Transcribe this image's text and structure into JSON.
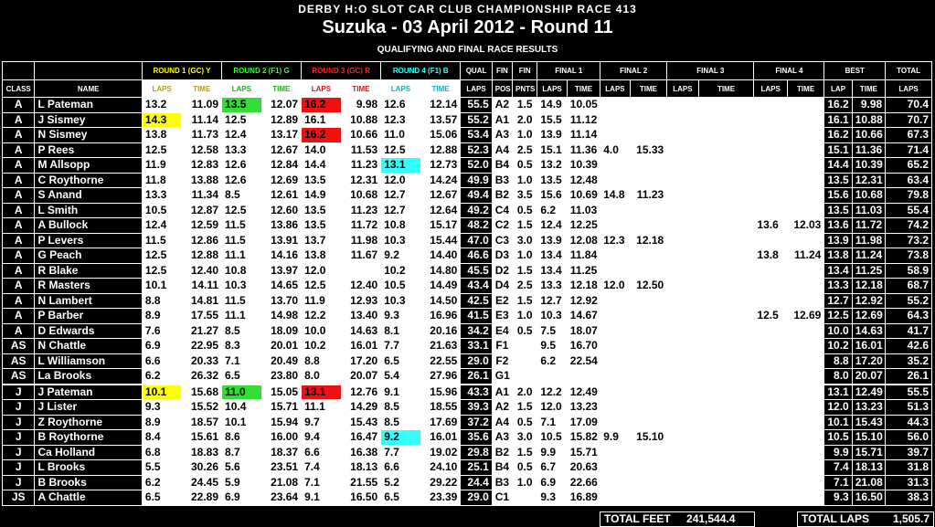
{
  "header": {
    "line1": "DERBY H:O SLOT CAR CLUB CHAMPIONSHIP RACE 413",
    "line2": "Suzuka - 03 April 2012 - Round 11",
    "line3": "QUALIFYING AND FINAL RACE RESULTS"
  },
  "columns": {
    "class": "CLASS",
    "name": "NAME",
    "r1": "ROUND 1 (GC) Y",
    "r2": "ROUND 2 (F1) G",
    "r3": "ROUND 3 (GC) R",
    "r4": "ROUND 4 (F1) B",
    "qual": "QUAL",
    "fin": "FIN",
    "fin2": "FIN",
    "final1": "FINAL 1",
    "final2": "FINAL 2",
    "final3": "FINAL 3",
    "final4": "FINAL 4",
    "best": "BEST",
    "total": "TOTAL",
    "laps": "LAPS",
    "time": "TIME",
    "pos": "POS",
    "pnts": "PNTS",
    "lap": "LAP"
  },
  "rows": [
    [
      "A",
      "L Pateman",
      "13.2",
      "11.09",
      "13.5",
      "12.07",
      "16.2",
      "9.98",
      "12.6",
      "12.14",
      "55.5",
      "A2",
      "1.5",
      "14.9",
      "10.05",
      "",
      "",
      "",
      "",
      "",
      "",
      "16.2",
      "9.98",
      "70.4"
    ],
    [
      "A",
      "J Sismey",
      "14.3",
      "11.14",
      "12.5",
      "12.89",
      "16.1",
      "10.88",
      "12.3",
      "13.57",
      "55.2",
      "A1",
      "2.0",
      "15.5",
      "11.12",
      "",
      "",
      "",
      "",
      "",
      "",
      "16.1",
      "10.88",
      "70.7"
    ],
    [
      "A",
      "N Sismey",
      "13.8",
      "11.73",
      "12.4",
      "13.17",
      "16.2",
      "10.66",
      "11.0",
      "15.06",
      "53.4",
      "A3",
      "1.0",
      "13.9",
      "11.14",
      "",
      "",
      "",
      "",
      "",
      "",
      "16.2",
      "10.66",
      "67.3"
    ],
    [
      "A",
      "P Rees",
      "12.5",
      "12.58",
      "13.3",
      "12.67",
      "14.0",
      "11.53",
      "12.5",
      "12.88",
      "52.3",
      "A4",
      "2.5",
      "15.1",
      "11.36",
      "4.0",
      "15.33",
      "",
      "",
      "",
      "",
      "15.1",
      "11.36",
      "71.4"
    ],
    [
      "A",
      "M Allsopp",
      "11.9",
      "12.83",
      "12.6",
      "12.84",
      "14.4",
      "11.23",
      "13.1",
      "12.73",
      "52.0",
      "B4",
      "0.5",
      "13.2",
      "10.39",
      "",
      "",
      "",
      "",
      "",
      "",
      "14.4",
      "10.39",
      "65.2"
    ],
    [
      "A",
      "C Roythorne",
      "11.8",
      "13.88",
      "12.6",
      "12.69",
      "13.5",
      "12.31",
      "12.0",
      "14.24",
      "49.9",
      "B3",
      "1.0",
      "13.5",
      "12.48",
      "",
      "",
      "",
      "",
      "",
      "",
      "13.5",
      "12.31",
      "63.4"
    ],
    [
      "A",
      "S Anand",
      "13.3",
      "11.34",
      "8.5",
      "12.61",
      "14.9",
      "10.68",
      "12.7",
      "12.67",
      "49.4",
      "B2",
      "3.5",
      "15.6",
      "10.69",
      "14.8",
      "11.23",
      "",
      "",
      "",
      "",
      "15.6",
      "10.68",
      "79.8"
    ],
    [
      "A",
      "L Smith",
      "10.5",
      "12.87",
      "12.5",
      "12.60",
      "13.5",
      "11.23",
      "12.7",
      "12.64",
      "49.2",
      "C4",
      "0.5",
      "6.2",
      "11.03",
      "",
      "",
      "",
      "",
      "",
      "",
      "13.5",
      "11.03",
      "55.4"
    ],
    [
      "A",
      "A Bullock",
      "12.4",
      "12.59",
      "11.5",
      "13.86",
      "13.5",
      "11.72",
      "10.8",
      "15.17",
      "48.2",
      "C2",
      "1.5",
      "12.4",
      "12.25",
      "",
      "",
      "",
      "",
      "13.6",
      "12.03",
      "13.6",
      "11.72",
      "74.2"
    ],
    [
      "A",
      "P Levers",
      "11.5",
      "12.86",
      "11.5",
      "13.91",
      "13.7",
      "11.98",
      "10.3",
      "15.44",
      "47.0",
      "C3",
      "3.0",
      "13.9",
      "12.08",
      "12.3",
      "12.18",
      "",
      "",
      "",
      "",
      "13.9",
      "11.98",
      "73.2"
    ],
    [
      "A",
      "G Peach",
      "12.5",
      "12.88",
      "11.1",
      "14.16",
      "13.8",
      "11.67",
      "9.2",
      "14.40",
      "46.6",
      "D3",
      "1.0",
      "13.4",
      "11.84",
      "",
      "",
      "",
      "",
      "13.8",
      "11.24",
      "13.8",
      "11.24",
      "73.8"
    ],
    [
      "A",
      "R Blake",
      "12.5",
      "12.40",
      "10.8",
      "13.97",
      "12.0",
      "",
      "10.2",
      "14.80",
      "45.5",
      "D2",
      "1.5",
      "13.4",
      "11.25",
      "",
      "",
      "",
      "",
      "",
      "",
      "13.4",
      "11.25",
      "58.9"
    ],
    [
      "A",
      "R Masters",
      "10.1",
      "14.11",
      "10.3",
      "14.65",
      "12.5",
      "12.40",
      "10.5",
      "14.49",
      "43.4",
      "D4",
      "2.5",
      "13.3",
      "12.18",
      "12.0",
      "12.50",
      "",
      "",
      "",
      "",
      "13.3",
      "12.18",
      "68.7"
    ],
    [
      "A",
      "N Lambert",
      "8.8",
      "14.81",
      "11.5",
      "13.70",
      "11.9",
      "12.93",
      "10.3",
      "14.50",
      "42.5",
      "E2",
      "1.5",
      "12.7",
      "12.92",
      "",
      "",
      "",
      "",
      "",
      "",
      "12.7",
      "12.92",
      "55.2"
    ],
    [
      "A",
      "P Barber",
      "8.9",
      "17.55",
      "11.1",
      "14.98",
      "12.2",
      "13.40",
      "9.3",
      "16.96",
      "41.5",
      "E3",
      "1.0",
      "10.3",
      "14.67",
      "",
      "",
      "",
      "",
      "12.5",
      "12.69",
      "12.5",
      "12.69",
      "64.3"
    ],
    [
      "A",
      "D Edwards",
      "7.6",
      "21.27",
      "8.5",
      "18.09",
      "10.0",
      "14.63",
      "8.1",
      "20.16",
      "34.2",
      "E4",
      "0.5",
      "7.5",
      "18.07",
      "",
      "",
      "",
      "",
      "",
      "",
      "10.0",
      "14.63",
      "41.7"
    ],
    [
      "AS",
      "N Chattle",
      "6.9",
      "22.95",
      "8.3",
      "20.01",
      "10.2",
      "16.01",
      "7.7",
      "21.63",
      "33.1",
      "F1",
      "",
      "9.5",
      "16.70",
      "",
      "",
      "",
      "",
      "",
      "",
      "10.2",
      "16.01",
      "42.6"
    ],
    [
      "AS",
      "L Williamson",
      "6.6",
      "20.33",
      "7.1",
      "20.49",
      "8.8",
      "17.20",
      "6.5",
      "22.55",
      "29.0",
      "F2",
      "",
      "6.2",
      "22.54",
      "",
      "",
      "",
      "",
      "",
      "",
      "8.8",
      "17.20",
      "35.2"
    ],
    [
      "AS",
      "La Brooks",
      "6.2",
      "26.32",
      "6.5",
      "23.80",
      "8.0",
      "20.07",
      "5.4",
      "27.96",
      "26.1",
      "G1",
      "",
      "",
      "",
      "",
      "",
      "",
      "",
      "",
      "",
      "8.0",
      "20.07",
      "26.1"
    ],
    [
      "J",
      "J Pateman",
      "10.1",
      "15.68",
      "11.0",
      "15.05",
      "13.1",
      "12.76",
      "9.1",
      "15.96",
      "43.3",
      "A1",
      "2.0",
      "12.2",
      "12.49",
      "",
      "",
      "",
      "",
      "",
      "",
      "13.1",
      "12.49",
      "55.5"
    ],
    [
      "J",
      "J Lister",
      "9.3",
      "15.52",
      "10.4",
      "15.71",
      "11.1",
      "14.29",
      "8.5",
      "18.55",
      "39.3",
      "A2",
      "1.5",
      "12.0",
      "13.23",
      "",
      "",
      "",
      "",
      "",
      "",
      "12.0",
      "13.23",
      "51.3"
    ],
    [
      "J",
      "Z Roythorne",
      "8.9",
      "18.57",
      "10.1",
      "15.94",
      "9.7",
      "15.43",
      "8.5",
      "17.69",
      "37.2",
      "A4",
      "0.5",
      "7.1",
      "17.09",
      "",
      "",
      "",
      "",
      "",
      "",
      "10.1",
      "15.43",
      "44.3"
    ],
    [
      "J",
      "B Roythorne",
      "8.4",
      "15.61",
      "8.6",
      "16.00",
      "9.4",
      "16.47",
      "9.2",
      "16.01",
      "35.6",
      "A3",
      "3.0",
      "10.5",
      "15.82",
      "9.9",
      "15.10",
      "",
      "",
      "",
      "",
      "10.5",
      "15.10",
      "56.0"
    ],
    [
      "J",
      "Ca Holland",
      "6.8",
      "18.83",
      "8.7",
      "18.37",
      "6.6",
      "16.38",
      "7.7",
      "19.02",
      "29.8",
      "B2",
      "1.5",
      "9.9",
      "15.71",
      "",
      "",
      "",
      "",
      "",
      "",
      "9.9",
      "15.71",
      "39.7"
    ],
    [
      "J",
      "L Brooks",
      "5.5",
      "30.26",
      "5.6",
      "23.51",
      "7.4",
      "18.13",
      "6.6",
      "24.10",
      "25.1",
      "B4",
      "0.5",
      "6.7",
      "20.63",
      "",
      "",
      "",
      "",
      "",
      "",
      "7.4",
      "18.13",
      "31.8"
    ],
    [
      "J",
      "B Brooks",
      "6.2",
      "24.45",
      "5.9",
      "21.08",
      "7.1",
      "21.55",
      "5.2",
      "29.22",
      "24.4",
      "B3",
      "1.0",
      "6.9",
      "22.66",
      "",
      "",
      "",
      "",
      "",
      "",
      "7.1",
      "21.08",
      "31.3"
    ],
    [
      "JS",
      "A Chattle",
      "6.5",
      "22.89",
      "6.9",
      "23.64",
      "9.1",
      "16.50",
      "6.5",
      "23.39",
      "29.0",
      "C1",
      "",
      "9.3",
      "16.89",
      "",
      "",
      "",
      "",
      "",
      "",
      "9.3",
      "16.50",
      "38.3"
    ]
  ],
  "highlights": [
    {
      "row": 0,
      "col": 4,
      "color": "green"
    },
    {
      "row": 0,
      "col": 6,
      "color": "red"
    },
    {
      "row": 1,
      "col": 2,
      "color": "yellow"
    },
    {
      "row": 2,
      "col": 6,
      "color": "red"
    },
    {
      "row": 4,
      "col": 8,
      "color": "cyan"
    },
    {
      "row": 19,
      "col": 2,
      "color": "yellow"
    },
    {
      "row": 19,
      "col": 4,
      "color": "green"
    },
    {
      "row": 19,
      "col": 6,
      "color": "red"
    },
    {
      "row": 22,
      "col": 8,
      "color": "cyan"
    }
  ],
  "colors": {
    "yellow": "#ffff00",
    "green": "#33dd33",
    "red": "#ee1111",
    "cyan": "#33ffff"
  },
  "totals": {
    "feet_label": "TOTAL FEET",
    "feet_value": "241,544.4",
    "laps_label": "TOTAL LAPS",
    "laps_value": "1,505.7"
  }
}
